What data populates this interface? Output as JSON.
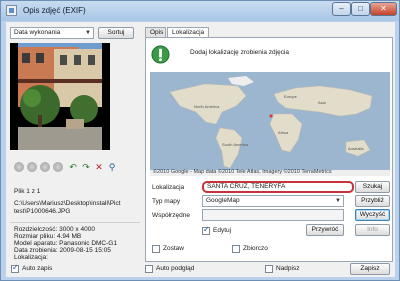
{
  "window": {
    "title": "Opis zdjęć (EXIF)",
    "minimize": "–",
    "maximize": "□",
    "close": "✕"
  },
  "left": {
    "sort_select": "Data wykonania",
    "sort_button": "Sortuj",
    "file_counter": "Plik 1 z 1",
    "file_path": [
      "C:\\Users\\Mariusz\\Desktop\\install\\Pict",
      "test\\P1000646.JPG"
    ],
    "exif_lines": [
      "Rozdzielczość: 3000 x 4000",
      "Rozmiar pliku: 4.94 MB",
      "Model aparatu: Panasonic DMC-G1",
      "Data zrobienia: 2009-08-15 15:05",
      "Lokalizacja:"
    ]
  },
  "tabs": [
    "Opis",
    "Lokalizacja"
  ],
  "location": {
    "hint": "Dodaj lokalizację zrobienia zdjęcia",
    "map_copyright": "©2010 Google - Map data ©2010 Tele Atlas, Imagery ©2010 TerraMetrics",
    "location_label": "Lokalizacja",
    "location_value": "SANTA CRUZ, TENERYFA",
    "search_button": "Szukaj",
    "map_type_label": "Typ mapy",
    "map_type_value": "GoogleMap",
    "zoom_button": "Przybliż",
    "coords_label": "Współrzędne",
    "coords_value": "",
    "clear_button": "Wyczyść",
    "edit_label": "Edytuj",
    "assign_button": "Przywróć",
    "info_button": "Info",
    "save_chk_label": "Zostaw",
    "collective_label": "Zbiorczo"
  },
  "bottom": {
    "autosave_label": "Auto zapis",
    "autopreview_label": "Auto podgląd",
    "overwrite_label": "Nadpisz",
    "save_button": "Zapisz"
  },
  "colors": {
    "titlebar": "#a9c6e6",
    "location_border": "#c8323a",
    "map_water": "#9db6cf",
    "map_land": "#e2dccb"
  }
}
